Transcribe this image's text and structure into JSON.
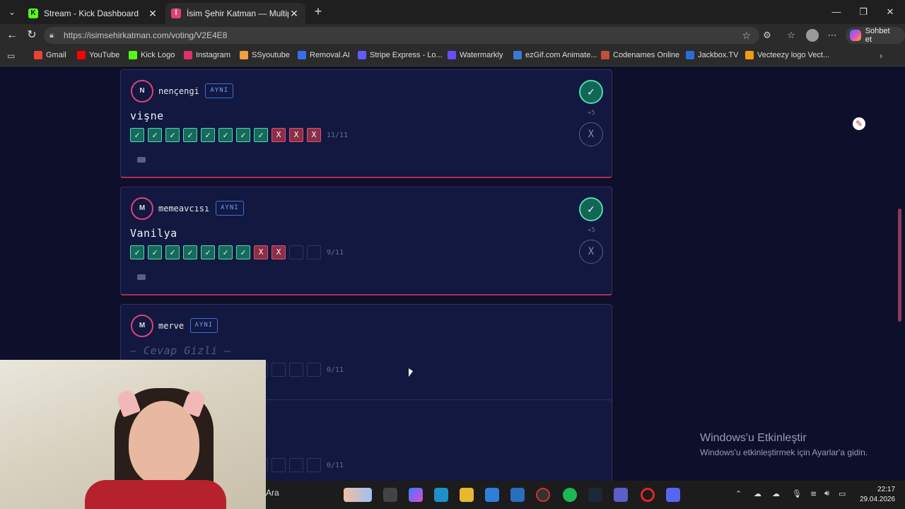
{
  "browser": {
    "tabs": [
      {
        "title": "Stream - Kick Dashboard",
        "favicon": "kick-icon",
        "color": "#53fc18"
      },
      {
        "title": "İsim Şehir Katman — Multiplayer İ",
        "favicon": "game-icon",
        "color": "#e0407a"
      }
    ],
    "url": "https://isimsehirkatman.com/voting/V2E4E8",
    "copilot_label": "Sohbet et",
    "bookmarks": [
      {
        "label": "Gmail",
        "icon": "gmail-icon",
        "color": "#ea4335"
      },
      {
        "label": "YouTube",
        "icon": "youtube-icon",
        "color": "#ff0000"
      },
      {
        "label": "Kick Logo",
        "icon": "kick-icon",
        "color": "#53fc18"
      },
      {
        "label": "Instagram",
        "icon": "instagram-icon",
        "color": "#e1306c"
      },
      {
        "label": "SSyoutube",
        "icon": "ssyoutube-icon",
        "color": "#f0a040"
      },
      {
        "label": "Removal.AI",
        "icon": "removal-ai-icon",
        "color": "#3a6cf0"
      },
      {
        "label": "Stripe Express - Lo...",
        "icon": "stripe-icon",
        "color": "#635bff"
      },
      {
        "label": "Watermarkly",
        "icon": "watermarkly-icon",
        "color": "#6b4cff"
      },
      {
        "label": "ezGif.com Animate...",
        "icon": "ezgif-icon",
        "color": "#3a7bd5"
      },
      {
        "label": "Codenames Online",
        "icon": "codenames-icon",
        "color": "#c0503a"
      },
      {
        "label": "Jackbox.TV",
        "icon": "jackbox-icon",
        "color": "#2d6cdf"
      },
      {
        "label": "Vecteezy logo Vect...",
        "icon": "vecteezy-icon",
        "color": "#f39c12"
      }
    ]
  },
  "cards": [
    {
      "initial": "N",
      "username": "nençengi",
      "badge": "AYNI",
      "answer": "vişne",
      "hidden": false,
      "boxes": [
        "ok",
        "ok",
        "ok",
        "ok",
        "ok",
        "ok",
        "ok",
        "ok",
        "no",
        "no",
        "no"
      ],
      "count": "11/11",
      "points": "+5"
    },
    {
      "initial": "M",
      "username": "memeavcısı",
      "badge": "AYNI",
      "answer": "Vanilya",
      "hidden": false,
      "boxes": [
        "ok",
        "ok",
        "ok",
        "ok",
        "ok",
        "ok",
        "ok",
        "no",
        "no",
        "em",
        "em"
      ],
      "count": "9/11",
      "points": "+5"
    },
    {
      "initial": "M",
      "username": "merve",
      "badge": "AYNI",
      "answer": "— Cevap Gizli —",
      "hidden": true,
      "boxes": [
        "em",
        "em",
        "em",
        "em",
        "em",
        "em",
        "em",
        "em",
        "em",
        "em",
        "em"
      ],
      "count": "0/11",
      "points": ""
    },
    {
      "initial": "",
      "username": "",
      "badge": "",
      "answer": "",
      "hidden": true,
      "boxes": [
        "em",
        "em",
        "em",
        "em",
        "em",
        "em",
        "em",
        "em",
        "em",
        "em",
        "em"
      ],
      "count": "0/11",
      "points": ""
    }
  ],
  "symbols": {
    "check": "✓",
    "cross": "X"
  },
  "windows_notice": {
    "title": "Windows'u Etkinleştir",
    "subtitle": "Windows'u etkinleştirmek için Ayarlar'a gidin."
  },
  "taskbar": {
    "search": "Ara",
    "time": "22:17",
    "date": "29.04.2026"
  }
}
